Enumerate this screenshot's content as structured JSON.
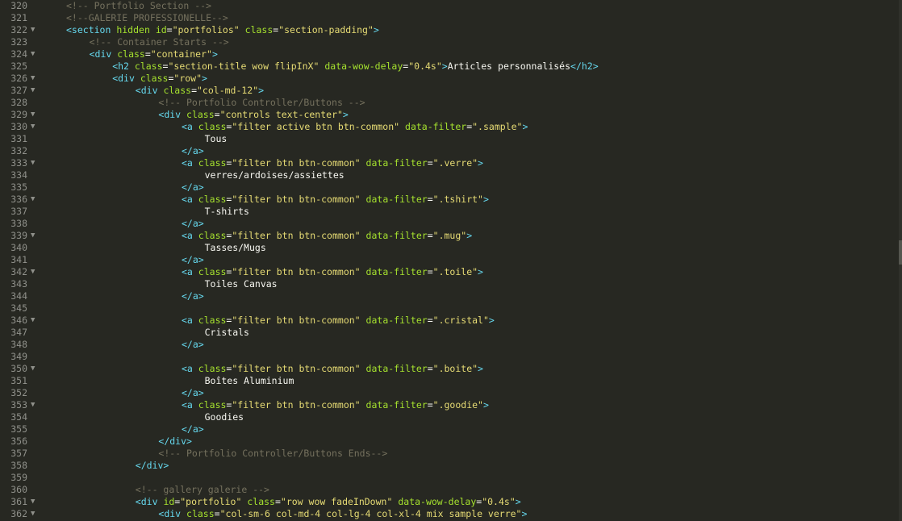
{
  "editor": {
    "lines": [
      {
        "num": "320",
        "fold": false,
        "indent": 1,
        "tokens": [
          {
            "t": "cmt",
            "s": "<!-- Portfolio Section -->"
          }
        ]
      },
      {
        "num": "321",
        "fold": false,
        "indent": 1,
        "tokens": [
          {
            "t": "cmt",
            "s": "<!--GALERIE PROFESSIONELLE-->"
          }
        ]
      },
      {
        "num": "322",
        "fold": true,
        "indent": 1,
        "tokens": [
          {
            "t": "tag",
            "s": "<section"
          },
          {
            "t": "text",
            "s": " "
          },
          {
            "t": "attr",
            "s": "hidden"
          },
          {
            "t": "text",
            "s": " "
          },
          {
            "t": "attr",
            "s": "id"
          },
          {
            "t": "eq",
            "s": "="
          },
          {
            "t": "val",
            "s": "\"portfolios\""
          },
          {
            "t": "text",
            "s": " "
          },
          {
            "t": "attr",
            "s": "class"
          },
          {
            "t": "eq",
            "s": "="
          },
          {
            "t": "val",
            "s": "\"section-padding\""
          },
          {
            "t": "tag",
            "s": ">"
          }
        ]
      },
      {
        "num": "323",
        "fold": false,
        "indent": 2,
        "tokens": [
          {
            "t": "cmt",
            "s": "<!-- Container Starts -->"
          }
        ]
      },
      {
        "num": "324",
        "fold": true,
        "indent": 2,
        "tokens": [
          {
            "t": "tag",
            "s": "<div"
          },
          {
            "t": "text",
            "s": " "
          },
          {
            "t": "attr",
            "s": "class"
          },
          {
            "t": "eq",
            "s": "="
          },
          {
            "t": "val",
            "s": "\"container\""
          },
          {
            "t": "tag",
            "s": ">"
          }
        ]
      },
      {
        "num": "325",
        "fold": false,
        "indent": 3,
        "tokens": [
          {
            "t": "tag",
            "s": "<h2"
          },
          {
            "t": "text",
            "s": " "
          },
          {
            "t": "attr",
            "s": "class"
          },
          {
            "t": "eq",
            "s": "="
          },
          {
            "t": "val",
            "s": "\"section-title wow flipInX\""
          },
          {
            "t": "text",
            "s": " "
          },
          {
            "t": "attr",
            "s": "data-wow-delay"
          },
          {
            "t": "eq",
            "s": "="
          },
          {
            "t": "val",
            "s": "\"0.4s\""
          },
          {
            "t": "tag",
            "s": ">"
          },
          {
            "t": "text",
            "s": "Articles personnalisés"
          },
          {
            "t": "tag",
            "s": "</h2>"
          }
        ]
      },
      {
        "num": "326",
        "fold": true,
        "indent": 3,
        "tokens": [
          {
            "t": "tag",
            "s": "<div"
          },
          {
            "t": "text",
            "s": " "
          },
          {
            "t": "attr",
            "s": "class"
          },
          {
            "t": "eq",
            "s": "="
          },
          {
            "t": "val",
            "s": "\"row\""
          },
          {
            "t": "tag",
            "s": ">"
          }
        ]
      },
      {
        "num": "327",
        "fold": true,
        "indent": 4,
        "tokens": [
          {
            "t": "tag",
            "s": "<div"
          },
          {
            "t": "text",
            "s": " "
          },
          {
            "t": "attr",
            "s": "class"
          },
          {
            "t": "eq",
            "s": "="
          },
          {
            "t": "val",
            "s": "\"col-md-12\""
          },
          {
            "t": "tag",
            "s": ">"
          }
        ]
      },
      {
        "num": "328",
        "fold": false,
        "indent": 5,
        "tokens": [
          {
            "t": "cmt",
            "s": "<!-- Portfolio Controller/Buttons -->"
          }
        ]
      },
      {
        "num": "329",
        "fold": true,
        "indent": 5,
        "tokens": [
          {
            "t": "tag",
            "s": "<div"
          },
          {
            "t": "text",
            "s": " "
          },
          {
            "t": "attr",
            "s": "class"
          },
          {
            "t": "eq",
            "s": "="
          },
          {
            "t": "val",
            "s": "\"controls text-center\""
          },
          {
            "t": "tag",
            "s": ">"
          }
        ]
      },
      {
        "num": "330",
        "fold": true,
        "indent": 6,
        "tokens": [
          {
            "t": "tag",
            "s": "<a"
          },
          {
            "t": "text",
            "s": " "
          },
          {
            "t": "attr",
            "s": "class"
          },
          {
            "t": "eq",
            "s": "="
          },
          {
            "t": "val",
            "s": "\"filter active btn btn-common\""
          },
          {
            "t": "text",
            "s": " "
          },
          {
            "t": "attr",
            "s": "data-filter"
          },
          {
            "t": "eq",
            "s": "="
          },
          {
            "t": "val",
            "s": "\".sample\""
          },
          {
            "t": "tag",
            "s": ">"
          }
        ]
      },
      {
        "num": "331",
        "fold": false,
        "indent": 7,
        "tokens": [
          {
            "t": "text",
            "s": "Tous"
          }
        ]
      },
      {
        "num": "332",
        "fold": false,
        "indent": 6,
        "tokens": [
          {
            "t": "tag",
            "s": "</a>"
          }
        ]
      },
      {
        "num": "333",
        "fold": true,
        "indent": 6,
        "tokens": [
          {
            "t": "tag",
            "s": "<a"
          },
          {
            "t": "text",
            "s": " "
          },
          {
            "t": "attr",
            "s": "class"
          },
          {
            "t": "eq",
            "s": "="
          },
          {
            "t": "val",
            "s": "\"filter btn btn-common\""
          },
          {
            "t": "text",
            "s": " "
          },
          {
            "t": "attr",
            "s": "data-filter"
          },
          {
            "t": "eq",
            "s": "="
          },
          {
            "t": "val",
            "s": "\".verre\""
          },
          {
            "t": "tag",
            "s": ">"
          }
        ]
      },
      {
        "num": "334",
        "fold": false,
        "indent": 7,
        "tokens": [
          {
            "t": "text",
            "s": "verres/ardoises/assiettes"
          }
        ]
      },
      {
        "num": "335",
        "fold": false,
        "indent": 6,
        "tokens": [
          {
            "t": "tag",
            "s": "</a>"
          }
        ]
      },
      {
        "num": "336",
        "fold": true,
        "indent": 6,
        "tokens": [
          {
            "t": "tag",
            "s": "<a"
          },
          {
            "t": "text",
            "s": " "
          },
          {
            "t": "attr",
            "s": "class"
          },
          {
            "t": "eq",
            "s": "="
          },
          {
            "t": "val",
            "s": "\"filter btn btn-common\""
          },
          {
            "t": "text",
            "s": " "
          },
          {
            "t": "attr",
            "s": "data-filter"
          },
          {
            "t": "eq",
            "s": "="
          },
          {
            "t": "val",
            "s": "\".tshirt\""
          },
          {
            "t": "tag",
            "s": ">"
          }
        ]
      },
      {
        "num": "337",
        "fold": false,
        "indent": 7,
        "tokens": [
          {
            "t": "text",
            "s": "T-shirts"
          }
        ]
      },
      {
        "num": "338",
        "fold": false,
        "indent": 6,
        "tokens": [
          {
            "t": "tag",
            "s": "</a>"
          }
        ]
      },
      {
        "num": "339",
        "fold": true,
        "indent": 6,
        "tokens": [
          {
            "t": "tag",
            "s": "<a"
          },
          {
            "t": "text",
            "s": " "
          },
          {
            "t": "attr",
            "s": "class"
          },
          {
            "t": "eq",
            "s": "="
          },
          {
            "t": "val",
            "s": "\"filter btn btn-common\""
          },
          {
            "t": "text",
            "s": " "
          },
          {
            "t": "attr",
            "s": "data-filter"
          },
          {
            "t": "eq",
            "s": "="
          },
          {
            "t": "val",
            "s": "\".mug\""
          },
          {
            "t": "tag",
            "s": ">"
          }
        ]
      },
      {
        "num": "340",
        "fold": false,
        "indent": 7,
        "tokens": [
          {
            "t": "text",
            "s": "Tasses/Mugs"
          }
        ]
      },
      {
        "num": "341",
        "fold": false,
        "indent": 6,
        "tokens": [
          {
            "t": "tag",
            "s": "</a>"
          }
        ]
      },
      {
        "num": "342",
        "fold": true,
        "indent": 6,
        "tokens": [
          {
            "t": "tag",
            "s": "<a"
          },
          {
            "t": "text",
            "s": " "
          },
          {
            "t": "attr",
            "s": "class"
          },
          {
            "t": "eq",
            "s": "="
          },
          {
            "t": "val",
            "s": "\"filter btn btn-common\""
          },
          {
            "t": "text",
            "s": " "
          },
          {
            "t": "attr",
            "s": "data-filter"
          },
          {
            "t": "eq",
            "s": "="
          },
          {
            "t": "val",
            "s": "\".toile\""
          },
          {
            "t": "tag",
            "s": ">"
          }
        ]
      },
      {
        "num": "343",
        "fold": false,
        "indent": 7,
        "tokens": [
          {
            "t": "text",
            "s": "Toiles Canvas"
          }
        ]
      },
      {
        "num": "344",
        "fold": false,
        "indent": 6,
        "tokens": [
          {
            "t": "tag",
            "s": "</a>"
          }
        ]
      },
      {
        "num": "345",
        "fold": false,
        "indent": 0,
        "tokens": []
      },
      {
        "num": "346",
        "fold": true,
        "indent": 6,
        "tokens": [
          {
            "t": "tag",
            "s": "<a"
          },
          {
            "t": "text",
            "s": " "
          },
          {
            "t": "attr",
            "s": "class"
          },
          {
            "t": "eq",
            "s": "="
          },
          {
            "t": "val",
            "s": "\"filter btn btn-common\""
          },
          {
            "t": "text",
            "s": " "
          },
          {
            "t": "attr",
            "s": "data-filter"
          },
          {
            "t": "eq",
            "s": "="
          },
          {
            "t": "val",
            "s": "\".cristal\""
          },
          {
            "t": "tag",
            "s": ">"
          }
        ]
      },
      {
        "num": "347",
        "fold": false,
        "indent": 7,
        "tokens": [
          {
            "t": "text",
            "s": "Cristals"
          }
        ]
      },
      {
        "num": "348",
        "fold": false,
        "indent": 6,
        "tokens": [
          {
            "t": "tag",
            "s": "</a>"
          }
        ]
      },
      {
        "num": "349",
        "fold": false,
        "indent": 0,
        "tokens": []
      },
      {
        "num": "350",
        "fold": true,
        "indent": 6,
        "tokens": [
          {
            "t": "tag",
            "s": "<a"
          },
          {
            "t": "text",
            "s": " "
          },
          {
            "t": "attr",
            "s": "class"
          },
          {
            "t": "eq",
            "s": "="
          },
          {
            "t": "val",
            "s": "\"filter btn btn-common\""
          },
          {
            "t": "text",
            "s": " "
          },
          {
            "t": "attr",
            "s": "data-filter"
          },
          {
            "t": "eq",
            "s": "="
          },
          {
            "t": "val",
            "s": "\".boite\""
          },
          {
            "t": "tag",
            "s": ">"
          }
        ]
      },
      {
        "num": "351",
        "fold": false,
        "indent": 7,
        "tokens": [
          {
            "t": "text",
            "s": "Boîtes Aluminium"
          }
        ]
      },
      {
        "num": "352",
        "fold": false,
        "indent": 6,
        "tokens": [
          {
            "t": "tag",
            "s": "</a>"
          }
        ]
      },
      {
        "num": "353",
        "fold": true,
        "indent": 6,
        "tokens": [
          {
            "t": "tag",
            "s": "<a"
          },
          {
            "t": "text",
            "s": " "
          },
          {
            "t": "attr",
            "s": "class"
          },
          {
            "t": "eq",
            "s": "="
          },
          {
            "t": "val",
            "s": "\"filter btn btn-common\""
          },
          {
            "t": "text",
            "s": " "
          },
          {
            "t": "attr",
            "s": "data-filter"
          },
          {
            "t": "eq",
            "s": "="
          },
          {
            "t": "val",
            "s": "\".goodie\""
          },
          {
            "t": "tag",
            "s": ">"
          }
        ]
      },
      {
        "num": "354",
        "fold": false,
        "indent": 7,
        "tokens": [
          {
            "t": "text",
            "s": "Goodies"
          }
        ]
      },
      {
        "num": "355",
        "fold": false,
        "indent": 6,
        "tokens": [
          {
            "t": "tag",
            "s": "</a>"
          }
        ]
      },
      {
        "num": "356",
        "fold": false,
        "indent": 5,
        "tokens": [
          {
            "t": "tag",
            "s": "</div>"
          }
        ]
      },
      {
        "num": "357",
        "fold": false,
        "indent": 5,
        "tokens": [
          {
            "t": "cmt",
            "s": "<!-- Portfolio Controller/Buttons Ends-->"
          }
        ]
      },
      {
        "num": "358",
        "fold": false,
        "indent": 4,
        "tokens": [
          {
            "t": "tag",
            "s": "</div>"
          }
        ]
      },
      {
        "num": "359",
        "fold": false,
        "indent": 0,
        "tokens": []
      },
      {
        "num": "360",
        "fold": false,
        "indent": 4,
        "tokens": [
          {
            "t": "cmt",
            "s": "<!-- gallery galerie -->"
          }
        ]
      },
      {
        "num": "361",
        "fold": true,
        "indent": 4,
        "tokens": [
          {
            "t": "tag",
            "s": "<div"
          },
          {
            "t": "text",
            "s": " "
          },
          {
            "t": "attr",
            "s": "id"
          },
          {
            "t": "eq",
            "s": "="
          },
          {
            "t": "val",
            "s": "\"portfolio\""
          },
          {
            "t": "text",
            "s": " "
          },
          {
            "t": "attr",
            "s": "class"
          },
          {
            "t": "eq",
            "s": "="
          },
          {
            "t": "val",
            "s": "\"row wow fadeInDown\""
          },
          {
            "t": "text",
            "s": " "
          },
          {
            "t": "attr",
            "s": "data-wow-delay"
          },
          {
            "t": "eq",
            "s": "="
          },
          {
            "t": "val",
            "s": "\"0.4s\""
          },
          {
            "t": "tag",
            "s": ">"
          }
        ]
      },
      {
        "num": "362",
        "fold": true,
        "indent": 5,
        "tokens": [
          {
            "t": "tag",
            "s": "<div"
          },
          {
            "t": "text",
            "s": " "
          },
          {
            "t": "attr",
            "s": "class"
          },
          {
            "t": "eq",
            "s": "="
          },
          {
            "t": "val",
            "s": "\"col-sm-6 col-md-4 col-lg-4 col-xl-4 mix sample verre\""
          },
          {
            "t": "tag",
            "s": ">"
          }
        ]
      }
    ]
  }
}
